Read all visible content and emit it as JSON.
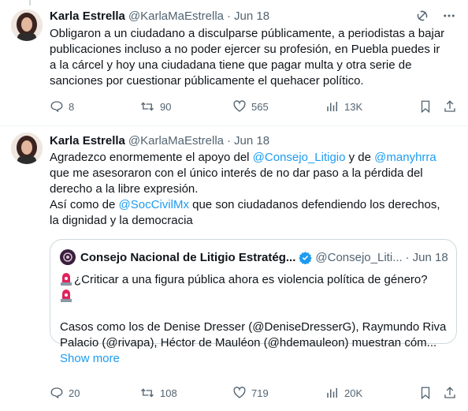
{
  "tweets": [
    {
      "name": "Karla Estrella",
      "handle": "@KarlaMaEstrella",
      "dot": "·",
      "date": "Jun 18",
      "lines": [
        "Obligaron a un ciudadano a disculparse públicamente, a periodistas a bajar",
        "publicaciones incluso a no poder ejercer su profesión, en Puebla puedes ir",
        "a la cárcel y hoy una ciudadana tiene que pagar multa y otra serie de",
        "sanciones por cuestionar públicamente el quehacer político."
      ],
      "replies": "8",
      "retweets": "90",
      "likes": "565",
      "views": "13K"
    },
    {
      "name": "Karla Estrella",
      "handle": "@KarlaMaEstrella",
      "dot": "·",
      "date": "Jun 18",
      "p1_a": "Agradezco enormemente el apoyo del ",
      "p1_m1": "@Consejo_Litigio",
      "p1_b": " y de ",
      "p1_m2": "@manyhrra",
      "p1_c": "que me asesoraron con el único interés de no dar paso a la pérdida del",
      "p1_d": "derecho a la libre expresión.",
      "p2_a": "Así como de ",
      "p2_m": "@SocCivilMx",
      "p2_b": " que son ciudadanos defendiendo los derechos,",
      "p2_c": "la dignidad y la democracia",
      "replies": "20",
      "retweets": "108",
      "likes": "719",
      "views": "20K"
    }
  ],
  "quote": {
    "name": "Consejo Nacional de Litigio Estratég...",
    "handle": "@Consejo_Liti...",
    "dot": "·",
    "date": "Jun 18",
    "line1": "¿Criticar a una figura pública ahora es violencia política de género?",
    "line2": "Casos como los de Denise Dresser (@DeniseDresserG), Raymundo Riva",
    "line3": "Palacio (@rivapa), Héctor de Mauléon (@hdemauleon) muestran cóm...",
    "show_more": "Show more"
  },
  "colors": {
    "accent": "#1d9bf0",
    "muted": "#536471",
    "text": "#0f1419",
    "border": "#cfd9de"
  },
  "icons": [
    "grok-icon",
    "more-icon",
    "reply-icon",
    "retweet-icon",
    "like-icon",
    "views-icon",
    "bookmark-icon",
    "share-icon",
    "verified-icon",
    "siren-emoji"
  ]
}
